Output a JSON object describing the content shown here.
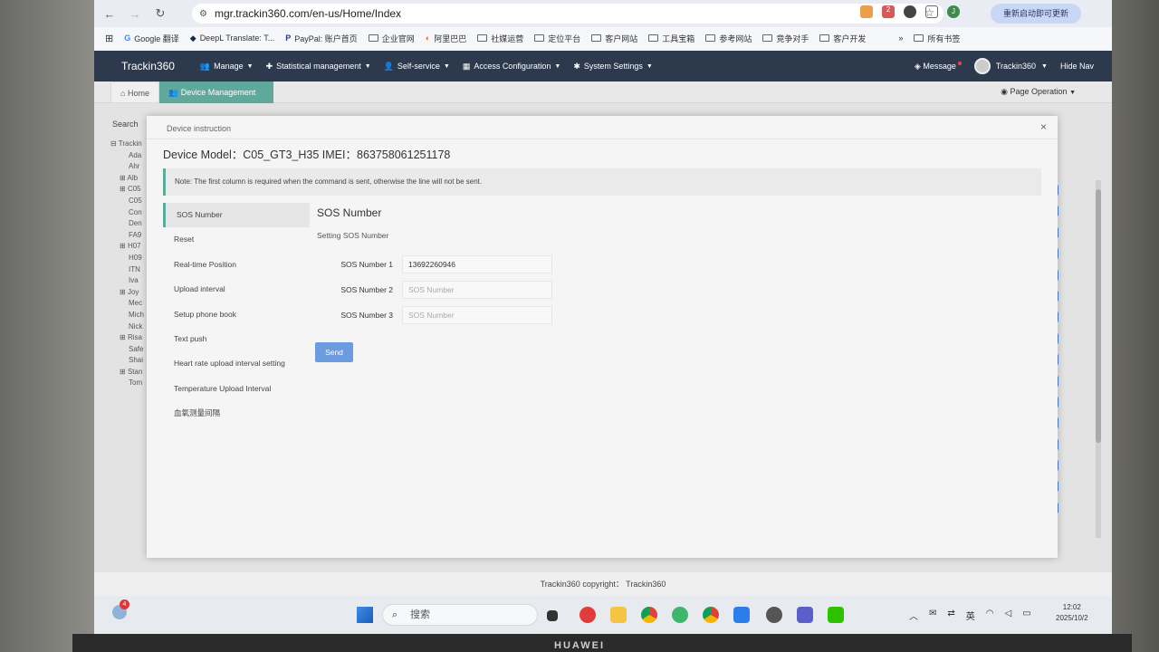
{
  "browser": {
    "url": "mgr.trackin360.com/en-us/Home/Index",
    "update_button": "重新启动即可更新",
    "bookmarks": [
      "Google 翻译",
      "DeepL Translate: T...",
      "PayPal: 账户首页",
      "企业官网",
      "阿里巴巴",
      "社媒运营",
      "定位平台",
      "客户网站",
      "工具宝箱",
      "参考网站",
      "竞争对手",
      "客户开发"
    ],
    "bookmarks_all": "所有书签",
    "ext_badge": "2",
    "profile_initial": "J"
  },
  "app": {
    "brand": "Trackin360",
    "menus": [
      "Manage",
      "Statistical management",
      "Self-service",
      "Access Configuration",
      "System Settings"
    ],
    "message": "Message",
    "user": "Trackin360",
    "hide_nav": "Hide Nav"
  },
  "tabs": {
    "home": "Home",
    "device": "Device Management",
    "close": "×"
  },
  "page_operation": "Page Operation",
  "sidebar": {
    "search": "Search",
    "tree": [
      "Trackin",
      "Ada",
      "Ahr",
      "Alb",
      "C05",
      "C05",
      "Con",
      "Den",
      "FA9",
      "H07",
      "H09",
      "ITN",
      "Iva",
      "Joy",
      "Mec",
      "Mich",
      "Nick",
      "Risa",
      "Safe",
      "Shai",
      "Stan",
      "Tom"
    ]
  },
  "modal": {
    "title": "Device instruction",
    "device_model_label": "Device Model：",
    "device_model": "C05_GT3_H35",
    "imei_label": "IMEI：",
    "imei": "863758061251178",
    "note": "Note: The first column is required when the command is sent, otherwise the line will not be sent.",
    "commands": [
      "SOS Number",
      "Reset",
      "Real-time Position",
      "Upload interval",
      "Setup phone book",
      "Text push",
      "Heart rate upload interval setting",
      "Temperature Upload Interval",
      "血氧测量间隔"
    ],
    "panel_title": "SOS Number",
    "panel_subtitle": "Setting SOS Number",
    "fields": [
      {
        "label": "SOS Number 1",
        "value": "13692260946",
        "placeholder": "SOS Number"
      },
      {
        "label": "SOS Number 2",
        "value": "",
        "placeholder": "SOS Number"
      },
      {
        "label": "SOS Number 3",
        "value": "",
        "placeholder": "SOS Number"
      }
    ],
    "send": "Send",
    "close": "×"
  },
  "footer": "Trackin360 copyright： Trackin360",
  "taskbar": {
    "notification_count": "4",
    "search_placeholder": "搜索",
    "ime": "英",
    "time": "12:02",
    "date": "2025/10/2"
  },
  "device_brand": "HUAWEI",
  "colors": {
    "nav": "#2d3a4d",
    "accent": "#5fa99c",
    "send": "#6d9be0"
  }
}
